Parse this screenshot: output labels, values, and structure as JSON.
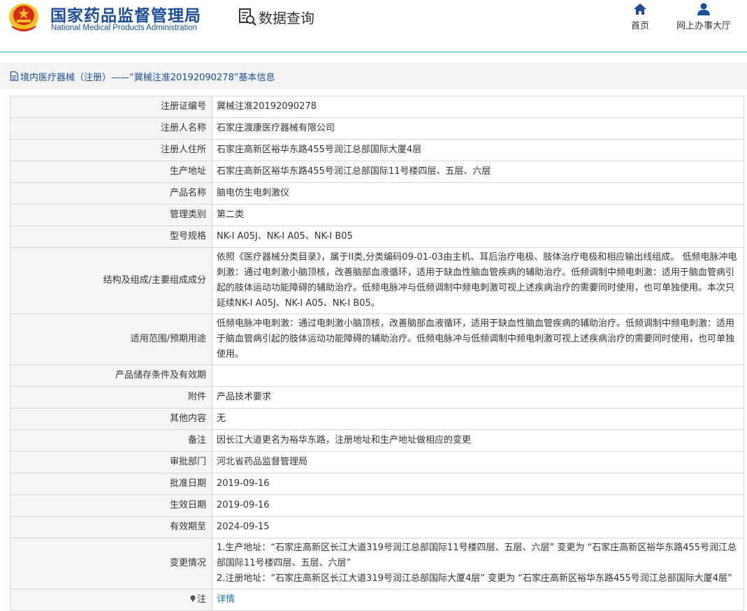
{
  "header": {
    "org_name_cn": "国家药品监督管理局",
    "org_name_en": "National Medical Products Administration",
    "query_label": "数据查询",
    "nav": [
      {
        "label": "首页",
        "icon": "home-icon"
      },
      {
        "label": "网上办事大厅",
        "icon": "user-icon"
      }
    ],
    "colors": {
      "brand": "#1a4d9c",
      "accent": "#2aa5c8"
    }
  },
  "breadcrumb": {
    "text": "境内医疗器械（注册）——“冀械注准20192090278”基本信息",
    "icon": "document-icon"
  },
  "table": {
    "rows": [
      {
        "label": "注册证编号",
        "value": "冀械注准20192090278"
      },
      {
        "label": "注册人名称",
        "value": "石家庄渡康医疗器械有限公司"
      },
      {
        "label": "注册人住所",
        "value": "石家庄高新区裕华东路455号润江总部国际大厦4层"
      },
      {
        "label": "生产地址",
        "value": "石家庄高新区裕华东路455号润江总部国际11号楼四层、五层、六层"
      },
      {
        "label": "产品名称",
        "value": "脑电仿生电刺激仪"
      },
      {
        "label": "管理类别",
        "value": "第二类"
      },
      {
        "label": "型号规格",
        "value": "NK-I A05J、NK-I A05、NK-I B05"
      },
      {
        "label": "结构及组成/主要组成成分",
        "value": "依照《医疗器械分类目录》，属于II类,分类编码09-01-03由主机、耳后治疗电极、肢体治疗电极和相应输出线组成。 低频电脉冲电刺激：通过电刺激小脑顶核，改善脑部血液循环，适用于缺血性脑血管疾病的辅助治疗。低频调制中频电刺激：适用于脑血管病引起的肢体运动功能障碍的辅助治疗。低频电脉冲与低频调制中频电刺激可视上述疾病治疗的需要同时使用，也可单独使用。本次只延续NK-I A05J、NK-I A05、NK-I B05。"
      },
      {
        "label": "适用范围/预期用途",
        "value": "低频电脉冲电刺激：通过电刺激小脑顶核，改善脑部血液循环，适用于缺血性脑血管疾病的辅助治疗。低频调制中频电刺激：适用于脑血管病引起的肢体运动功能障碍的辅助治疗。低频电脉冲与低频调制中频电刺激可视上述疾病治疗的需要同时使用，也可单独使用。"
      },
      {
        "label": "产品储存条件及有效期",
        "value": ""
      },
      {
        "label": "附件",
        "value": "产品技术要求"
      },
      {
        "label": "其他内容",
        "value": "无"
      },
      {
        "label": "备注",
        "value": "因长江大道更名为裕华东路，注册地址和生产地址做相应的变更"
      },
      {
        "label": "审批部门",
        "value": "河北省药品监督管理局"
      },
      {
        "label": "批准日期",
        "value": "2019-09-16"
      },
      {
        "label": "生效日期",
        "value": "2019-09-16"
      },
      {
        "label": "有效期至",
        "value": "2024-09-15"
      }
    ],
    "change": {
      "label": "变更情况",
      "line1": "1.生产地址：“石家庄高新区长江大道319号润江总部国际11号楼四层、五层、六层” 变更为 “石家庄高新区裕华东路455号润江总部国际11号楼四层、五层、六层”",
      "line2": "2.注册地址：“石家庄高新区长江大道319号润江总部国际大厦4层” 变更为 “石家庄高新区裕华东路455号润江总部国际大厦4层”"
    },
    "note": {
      "label": "注",
      "link": "详情",
      "icon": "pin-icon"
    }
  }
}
